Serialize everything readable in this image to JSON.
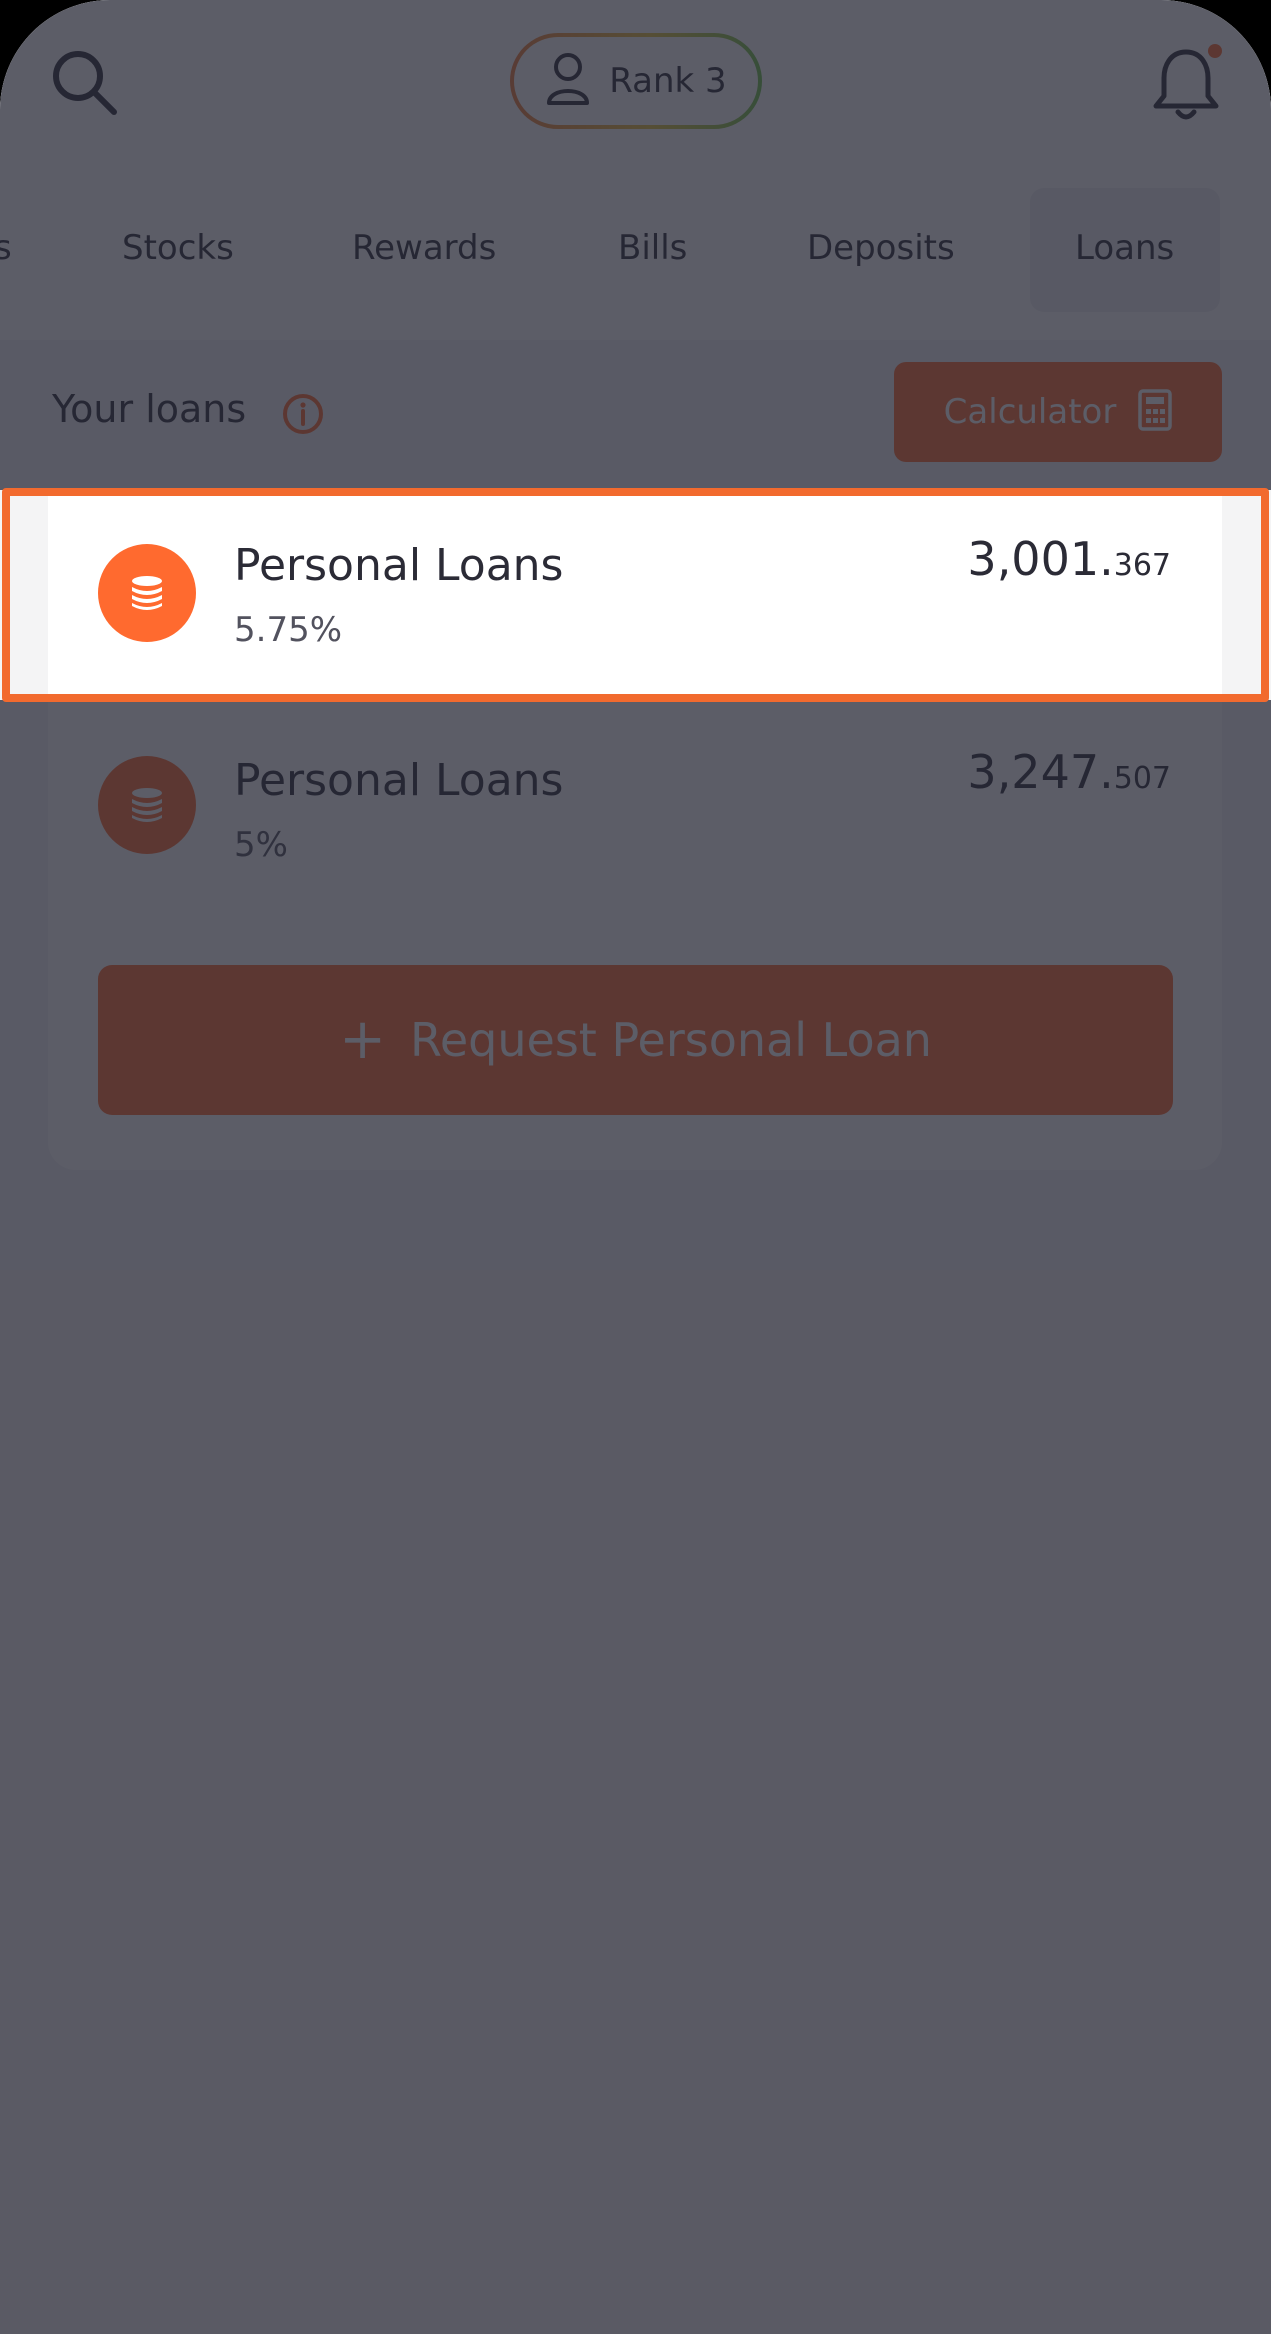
{
  "header": {
    "rank_label": "Rank 3",
    "icons": {
      "search": "search-icon",
      "user": "user-icon",
      "bell": "bell-icon"
    },
    "notification_dot": true
  },
  "tabs": {
    "items": [
      {
        "label": "s",
        "partial": true
      },
      {
        "label": "Stocks"
      },
      {
        "label": "Rewards"
      },
      {
        "label": "Bills"
      },
      {
        "label": "Deposits"
      },
      {
        "label": "Loans",
        "active": true
      }
    ]
  },
  "loans": {
    "section_title": "Your loans",
    "calculator_label": "Calculator",
    "items": [
      {
        "name": "Personal Loans",
        "rate": "5.75%",
        "amount_int": "3,001.",
        "amount_dec": "367",
        "highlighted": true
      },
      {
        "name": "Personal Loans",
        "rate": "5%",
        "amount_int": "3,247.",
        "amount_dec": "507",
        "highlighted": false
      }
    ],
    "request_label": "Request Personal Loan",
    "request_icon": "plus-icon"
  },
  "colors": {
    "accent": "#ff6a2f",
    "highlight_border": "#f26a2e",
    "text_primary": "#2b2b36",
    "overlay": "#262734"
  }
}
